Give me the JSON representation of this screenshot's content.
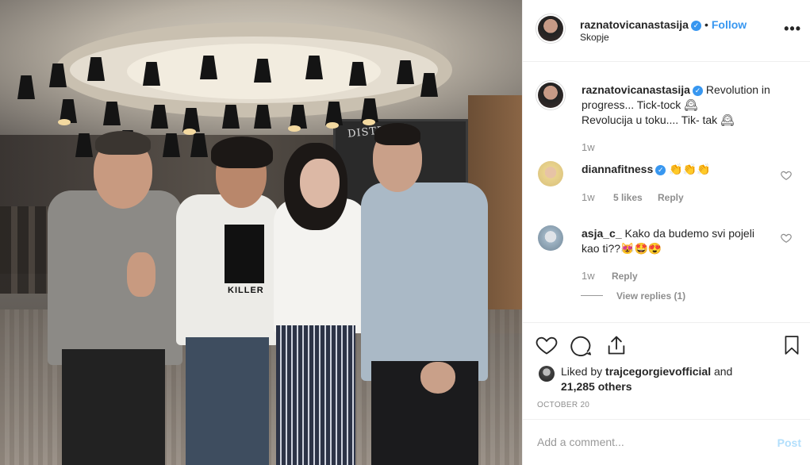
{
  "post": {
    "author": "raznatovicanastasija",
    "separator": "•",
    "follow_label": "Follow",
    "location": "Skopje",
    "more_glyph": "•••",
    "photo_text": {
      "blackboard": "DISTRIKT",
      "shirt": "KILLER"
    }
  },
  "caption": {
    "username": "raznatovicanastasija",
    "line1": "Revolution in",
    "line2": "progress... Tick-tock 🕰",
    "line3": "Revolucija u toku.... Tik- tak 🕰",
    "time": "1w"
  },
  "comments": [
    {
      "username": "diannafitness",
      "text": "👏👏👏",
      "time": "1w",
      "likes": "5 likes",
      "reply_label": "Reply"
    },
    {
      "username": "asja_c_",
      "text_line1": "Kako da budemo svi pojeli",
      "text_line2": "kao ti??😻🤩😍",
      "time": "1w",
      "reply_label": "Reply",
      "view_replies": "View replies (1)"
    }
  ],
  "likes": {
    "prefix": "Liked by",
    "user": "trajcegorgievofficial",
    "and": "and",
    "others": "21,285 others"
  },
  "date": "OCTOBER 20",
  "composer": {
    "placeholder": "Add a comment...",
    "post_label": "Post"
  },
  "colors": {
    "accent": "#3897f0",
    "post_disabled": "#b2dffc",
    "meta": "#8e8e8e",
    "text": "#262626"
  },
  "icons": [
    "verified-badge-icon",
    "more-options-icon",
    "heart-icon",
    "comment-icon",
    "share-icon",
    "bookmark-icon"
  ]
}
